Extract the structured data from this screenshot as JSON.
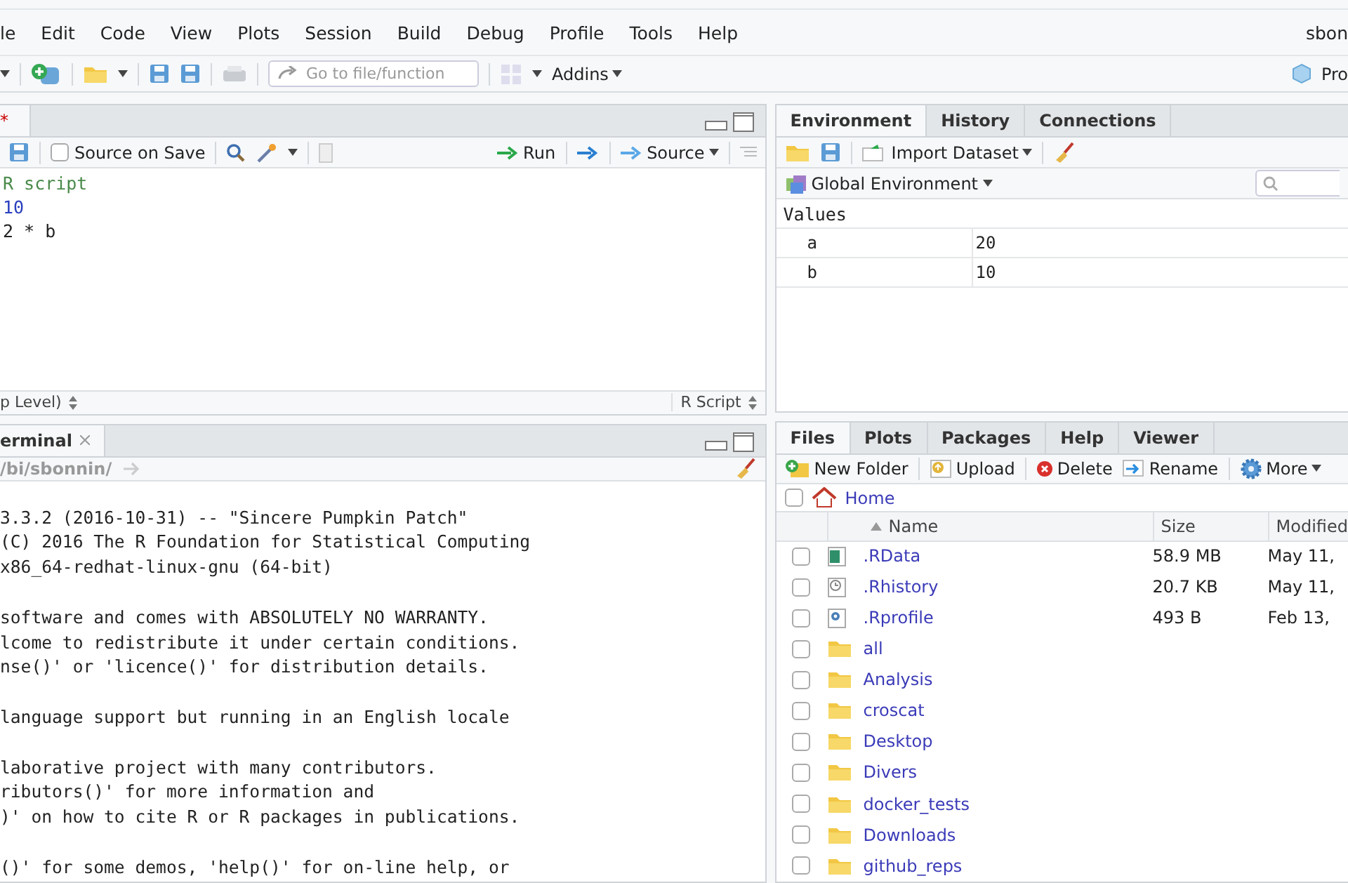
{
  "menu": [
    "le",
    "Edit",
    "Code",
    "View",
    "Plots",
    "Session",
    "Build",
    "Debug",
    "Profile",
    "Tools",
    "Help"
  ],
  "user": "sbon",
  "toolbar": {
    "goto_placeholder": "Go to file/function",
    "addins": "Addins",
    "project": "Pro"
  },
  "editor": {
    "tab": {
      "label": "*",
      "modified": true
    },
    "source_on_save": {
      "label": "Source on Save",
      "checked": false
    },
    "run": "Run",
    "source": "Source",
    "lines": [
      {
        "kind": "comment",
        "text": "R script"
      },
      {
        "kind": "number",
        "text": "10"
      },
      {
        "kind": "code",
        "text": "2 * b"
      }
    ],
    "scope": "p Level)",
    "filetype": "R Script"
  },
  "console": {
    "tab": "erminal",
    "path": "/bi/sbonnin/",
    "paragraphs": [
      [
        "3.3.2 (2016-10-31) -- \"Sincere Pumpkin Patch\"",
        "(C) 2016 The R Foundation for Statistical Computing",
        "x86_64-redhat-linux-gnu (64-bit)"
      ],
      [
        "software and comes with ABSOLUTELY NO WARRANTY.",
        "lcome to redistribute it under certain conditions.",
        "nse()' or 'licence()' for distribution details."
      ],
      [
        "language support but running in an English locale"
      ],
      [
        "laborative project with many contributors.",
        "ributors()' for more information and",
        ")' on how to cite R or R packages in publications."
      ],
      [
        "()' for some demos, 'help()' for on-line help, or"
      ]
    ]
  },
  "environment": {
    "tabs": [
      {
        "label": "Environment",
        "selected": true
      },
      {
        "label": "History",
        "selected": false
      },
      {
        "label": "Connections",
        "selected": false
      }
    ],
    "import": "Import Dataset",
    "scope": "Global Environment",
    "section": "Values",
    "values": [
      {
        "name": "a",
        "value": "20"
      },
      {
        "name": "b",
        "value": "10"
      }
    ]
  },
  "files": {
    "tabs": [
      {
        "label": "Files",
        "selected": true
      },
      {
        "label": "Plots",
        "selected": false
      },
      {
        "label": "Packages",
        "selected": false
      },
      {
        "label": "Help",
        "selected": false
      },
      {
        "label": "Viewer",
        "selected": false
      }
    ],
    "actions": [
      {
        "kind": "newfolder",
        "label": "New Folder"
      },
      {
        "kind": "upload",
        "label": "Upload"
      },
      {
        "kind": "delete",
        "label": "Delete"
      },
      {
        "kind": "rename",
        "label": "Rename"
      },
      {
        "kind": "more",
        "label": "More"
      }
    ],
    "select_all_checked": false,
    "breadcrumb": "Home",
    "columns": [
      {
        "label": "Name",
        "sorted": true
      },
      {
        "label": "Size",
        "sorted": false
      },
      {
        "label": "Modified",
        "sorted": false
      }
    ],
    "rows": [
      {
        "kind": "rdata",
        "name": ".RData",
        "size": "58.9 MB",
        "modified": "May 11,",
        "checked": false
      },
      {
        "kind": "history",
        "name": ".Rhistory",
        "size": "20.7 KB",
        "modified": "May 11,",
        "checked": false
      },
      {
        "kind": "profile",
        "name": ".Rprofile",
        "size": "493 B",
        "modified": "Feb 13,",
        "checked": false
      },
      {
        "kind": "folder",
        "name": "all",
        "checked": false
      },
      {
        "kind": "folder",
        "name": "Analysis",
        "checked": false
      },
      {
        "kind": "folder",
        "name": "croscat",
        "checked": false
      },
      {
        "kind": "folder",
        "name": "Desktop",
        "checked": false
      },
      {
        "kind": "folder",
        "name": "Divers",
        "checked": false
      },
      {
        "kind": "folder",
        "name": "docker_tests",
        "checked": false
      },
      {
        "kind": "folder",
        "name": "Downloads",
        "checked": false
      },
      {
        "kind": "folder",
        "name": "github_reps",
        "checked": false
      }
    ]
  }
}
